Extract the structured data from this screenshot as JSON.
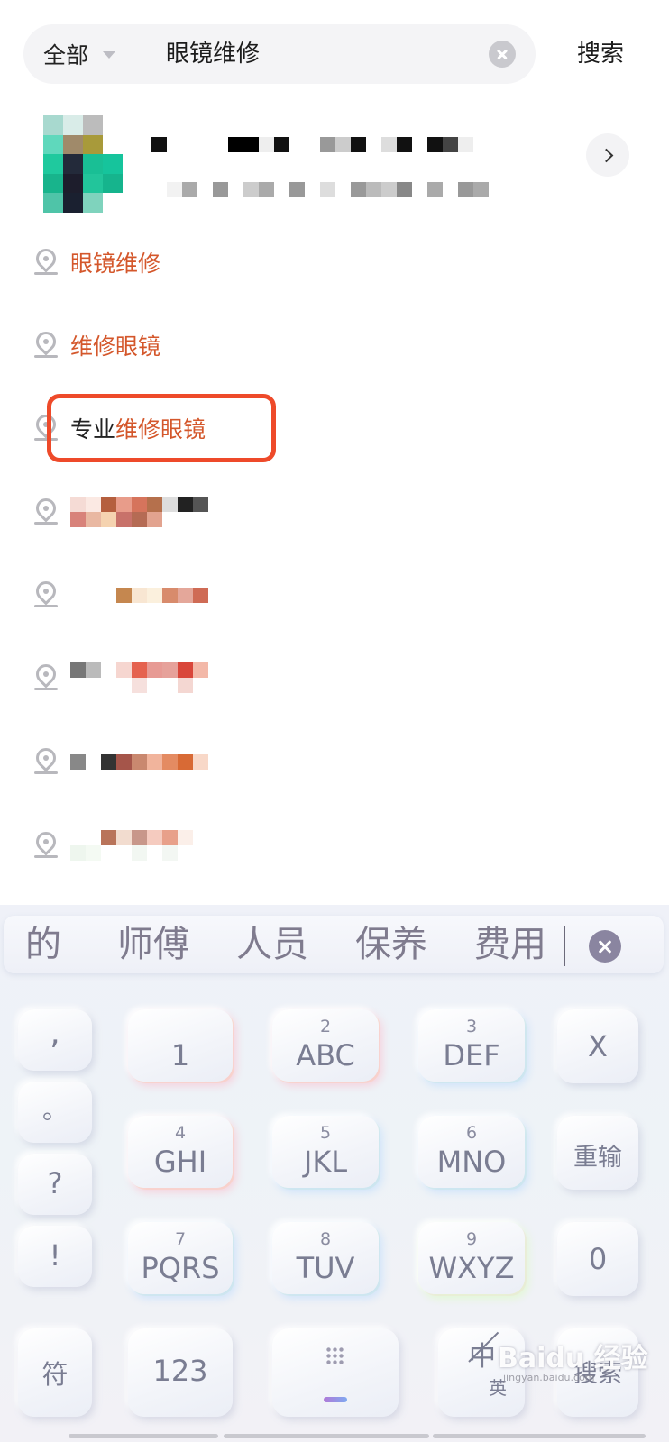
{
  "search": {
    "scope_label": "全部",
    "query": "眼镜维修",
    "submit_label": "搜索"
  },
  "suggestions": [
    {
      "parts": [
        {
          "text": "眼镜维修",
          "hl": true
        }
      ]
    },
    {
      "parts": [
        {
          "text": "维修眼镜",
          "hl": true
        }
      ]
    },
    {
      "parts": [
        {
          "text": "专业",
          "hl": false
        },
        {
          "text": "维修眼镜",
          "hl": true
        }
      ]
    }
  ],
  "keyboard": {
    "candidates": [
      "的",
      "师傅",
      "人员",
      "保养",
      "费用"
    ],
    "punct": [
      ",",
      "。",
      "?",
      "!"
    ],
    "keys": [
      {
        "num": "",
        "label": "1"
      },
      {
        "num": "2",
        "label": "ABC"
      },
      {
        "num": "3",
        "label": "DEF"
      },
      {
        "num": "4",
        "label": "GHI"
      },
      {
        "num": "5",
        "label": "JKL"
      },
      {
        "num": "6",
        "label": "MNO"
      },
      {
        "num": "7",
        "label": "PQRS"
      },
      {
        "num": "8",
        "label": "TUV"
      },
      {
        "num": "9",
        "label": "WXYZ"
      }
    ],
    "right_keys": [
      "X",
      "重输",
      "0",
      "搜索"
    ],
    "symbol_label": "符",
    "numeric_label": "123",
    "lang_main": "中",
    "lang_sub": "英"
  },
  "watermark": {
    "brand": "Baidu 经验",
    "url": "jingyan.baidu.com"
  },
  "colors": {
    "highlight": "#d4572b",
    "annotation_box": "#ee4a2a"
  }
}
